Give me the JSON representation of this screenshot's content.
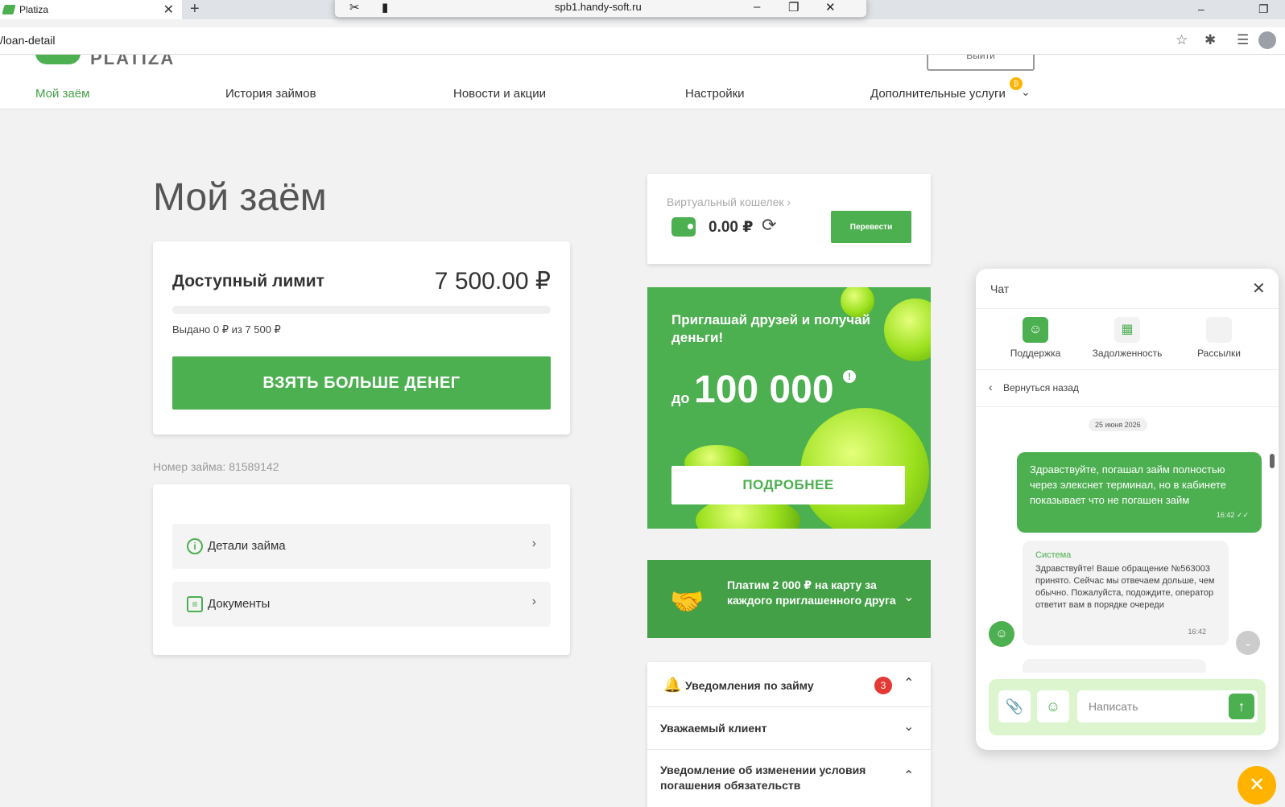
{
  "browser": {
    "tab_title": "Platiza",
    "tab_close": "✕",
    "new_tab": "+",
    "remote_host": "spb1.handy-soft.ru",
    "url": "/loan-detail",
    "win_min": "–",
    "win_max": "❐"
  },
  "header": {
    "logo_text": "PLATIZA",
    "logout_label": "Выйти",
    "nav": [
      "Мой заём",
      "История займов",
      "Новости и акции",
      "Настройки",
      "Дополнительные услуги"
    ],
    "nav_badge": "₿"
  },
  "main": {
    "title": "Мой заём",
    "limit": {
      "label": "Доступный лимит",
      "value": "7 500.00 ₽",
      "used_fraction": 0,
      "issued": "Выдано 0 ₽ из 7 500 ₽",
      "button": "ВЗЯТЬ БОЛЬШЕ ДЕНЕГ"
    },
    "loan_number": "Номер займа: 81589142",
    "links": [
      {
        "label": "Детали займа",
        "icon": "info-icon"
      },
      {
        "label": "Документы",
        "icon": "document-icon"
      }
    ]
  },
  "wallet": {
    "title": "Виртуальный кошелек",
    "amount": "0.00 ₽",
    "button": "Перевести"
  },
  "promo": {
    "title": "Приглашай друзей и получай деньги!",
    "prefix": "до",
    "amount": "100 000",
    "mark": "!",
    "button": "ПОДРОБНЕЕ"
  },
  "referral": {
    "text": "Платим 2 000 ₽ на карту за каждого приглашенного друга"
  },
  "notifications": {
    "title": "Уведомления по займу",
    "count": "3",
    "items": [
      "Уважаемый клиент",
      "Уведомление об изменении условия погашения обязательств"
    ]
  },
  "chat": {
    "title": "Чат",
    "tabs": [
      "Поддержка",
      "Задолженность",
      "Рассылки"
    ],
    "back": "Вернуться назад",
    "date": "25 июня 2026",
    "outgoing": {
      "text": "Здравствуйте, погашал займ полностью через элекснет терминал, но в кабинете показывает что не погашен займ",
      "time": "16:42"
    },
    "incoming": {
      "author": "Система",
      "text": "Здравствуйте! Ваше обращение №563003 принято. Сейчас мы отвечаем дольше, чем обычно. Пожалуйста, подождите, оператор ответит вам в порядке очереди",
      "time": "16:42"
    },
    "input_placeholder": "Написать"
  },
  "colors": {
    "brand_green": "#4caf50",
    "accent_orange": "#ffb300",
    "badge_red": "#e53935"
  }
}
